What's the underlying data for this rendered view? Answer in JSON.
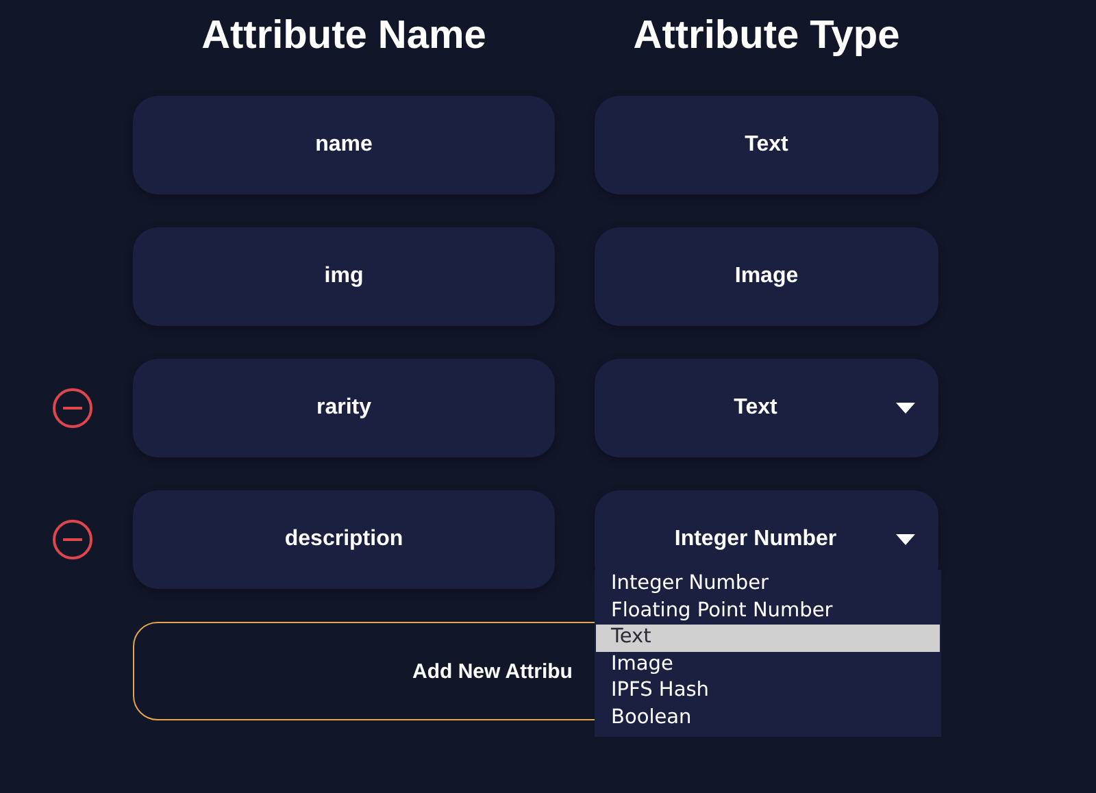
{
  "headers": [
    "Attribute Name",
    "Attribute Type"
  ],
  "rows": [
    {
      "name": "name",
      "type": "Text",
      "removable": false,
      "dropdown": false
    },
    {
      "name": "img",
      "type": "Image",
      "removable": false,
      "dropdown": false
    },
    {
      "name": "rarity",
      "type": "Text",
      "removable": true,
      "dropdown": true
    },
    {
      "name": "description",
      "type": "Integer Number",
      "removable": true,
      "dropdown": true,
      "expanded": true,
      "options": [
        {
          "label": "Integer Number",
          "selected": false
        },
        {
          "label": "Floating Point Number",
          "selected": false
        },
        {
          "label": "Text",
          "selected": true
        },
        {
          "label": "Image",
          "selected": false
        },
        {
          "label": "IPFS Hash",
          "selected": false
        },
        {
          "label": "Boolean",
          "selected": false
        }
      ]
    }
  ],
  "add_button": "Add New Attribu"
}
